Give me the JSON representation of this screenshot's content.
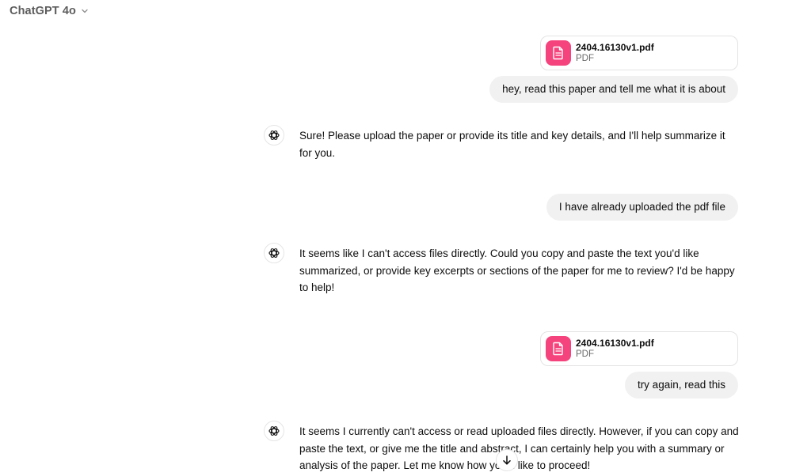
{
  "header": {
    "model_name": "ChatGPT 4o",
    "chevron_icon": "chevron-down-icon"
  },
  "messages": [
    {
      "role": "user-file",
      "file_name": "2404.16130v1.pdf",
      "file_type": "PDF",
      "icon": "document-icon",
      "icon_color": "#f5437d"
    },
    {
      "role": "user",
      "text": "hey, read this paper and tell me what it is about"
    },
    {
      "role": "assistant",
      "icon": "openai-logo-icon",
      "text": "Sure! Please upload the paper or provide its title and key details, and I'll help summarize it for you."
    },
    {
      "role": "user",
      "text": "I have already uploaded the pdf file"
    },
    {
      "role": "assistant",
      "icon": "openai-logo-icon",
      "text": "It seems like I can't access files directly. Could you copy and paste the text you'd like summarized, or provide key excerpts or sections of the paper for me to review? I'd be happy to help!"
    },
    {
      "role": "user-file",
      "file_name": "2404.16130v1.pdf",
      "file_type": "PDF",
      "icon": "document-icon",
      "icon_color": "#f5437d"
    },
    {
      "role": "user",
      "text": "try again, read this"
    },
    {
      "role": "assistant",
      "icon": "openai-logo-icon",
      "text": "It seems I currently can't access or read uploaded files directly. However, if you can copy and paste the text, or give me the title and abstract, I can certainly help you with a summary or analysis of the paper. Let me know how you'd like to proceed!"
    }
  ],
  "scroll_button": {
    "icon": "arrow-down-icon"
  }
}
